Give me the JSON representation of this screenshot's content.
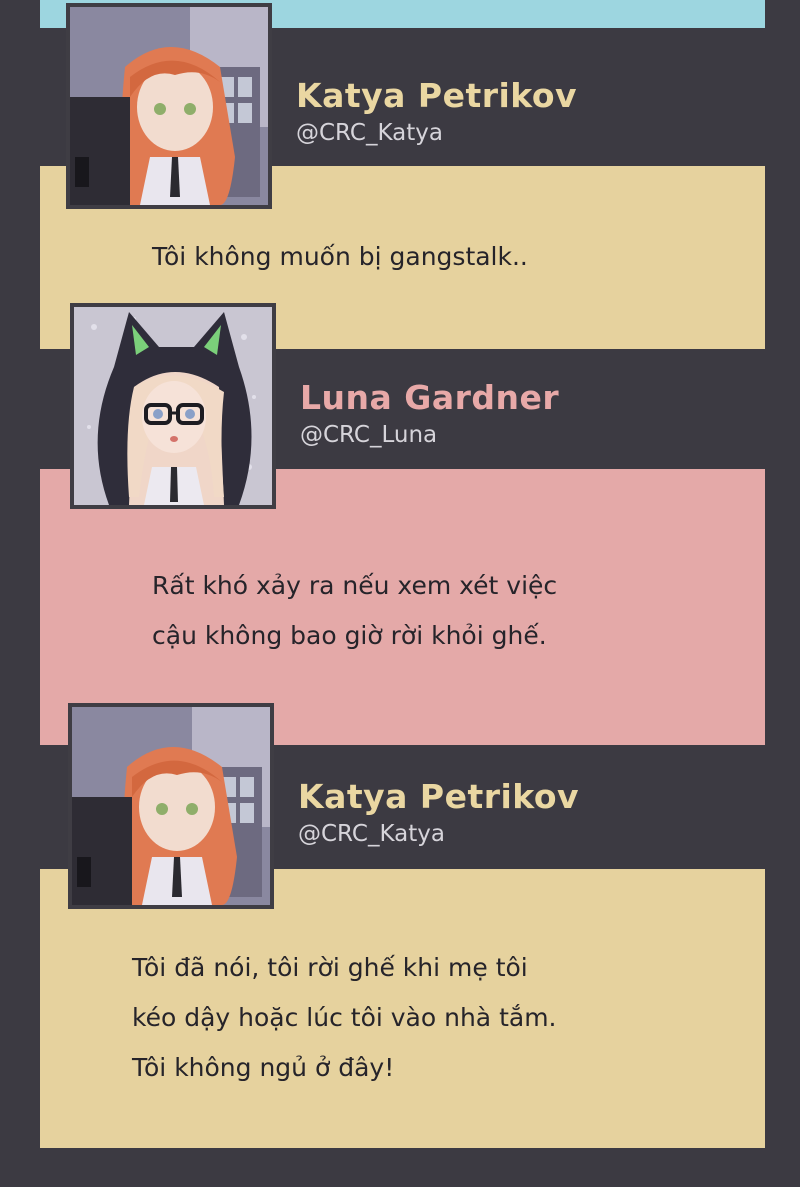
{
  "colors": {
    "background": "#3c3a42",
    "top_strip": "#9dd6e0",
    "katya_bubble": "#e6d29e",
    "luna_bubble": "#e4a9a8",
    "katya_name": "#ead7a2",
    "luna_name": "#e8a9a8",
    "handle": "#d6d4da",
    "message_text": "#26242a"
  },
  "messages": [
    {
      "author": "Katya Petrikov",
      "handle": "@CRC_Katya",
      "avatar": "katya-avatar",
      "lines": [
        "Tôi không muốn bị gangstalk.."
      ]
    },
    {
      "author": "Luna Gardner",
      "handle": "@CRC_Luna",
      "avatar": "luna-avatar",
      "lines": [
        "Rất khó xảy ra nếu xem xét việc",
        "cậu không bao giờ rời khỏi ghế."
      ]
    },
    {
      "author": "Katya Petrikov",
      "handle": "@CRC_Katya",
      "avatar": "katya-avatar",
      "lines": [
        "Tôi đã nói, tôi rời ghế khi mẹ tôi",
        "kéo dậy hoặc lúc tôi vào nhà tắm.",
        "Tôi không ngủ ở đây!"
      ]
    }
  ]
}
